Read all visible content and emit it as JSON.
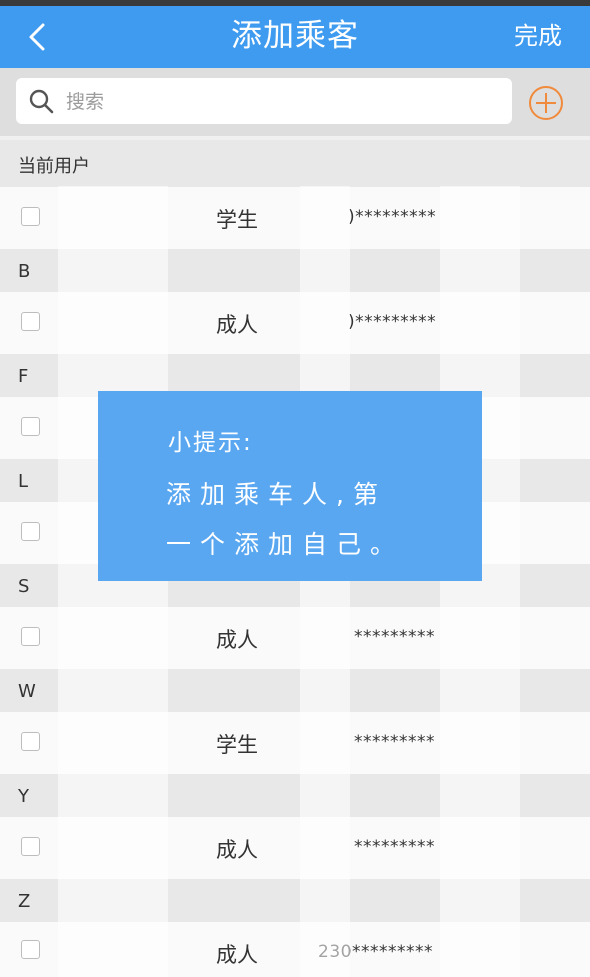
{
  "header": {
    "title": "添加乘客",
    "done_label": "完成"
  },
  "search": {
    "placeholder": "搜索"
  },
  "sections": [
    {
      "label": "当前用户",
      "rows": [
        {
          "type": "学生",
          "id_masked": ")*********"
        }
      ]
    },
    {
      "label": "B",
      "rows": [
        {
          "type": "成人",
          "id_masked": ")*********"
        }
      ]
    },
    {
      "label": "F",
      "rows": [
        {
          "type": "",
          "id_masked": ""
        }
      ]
    },
    {
      "label": "L",
      "rows": [
        {
          "type": "",
          "id_masked": ""
        }
      ]
    },
    {
      "label": "S",
      "rows": [
        {
          "type": "成人",
          "id_masked": "*********"
        }
      ]
    },
    {
      "label": "W",
      "rows": [
        {
          "type": "学生",
          "id_masked": "*********"
        }
      ]
    },
    {
      "label": "Y",
      "rows": [
        {
          "type": "成人",
          "id_masked": "*********"
        }
      ]
    },
    {
      "label": "Z",
      "rows": [
        {
          "type": "成人",
          "id_masked": "230*********"
        }
      ]
    }
  ],
  "tip": {
    "title": "小提示:",
    "line1": "添加乘车人,第",
    "line2": "一个添加自己。"
  },
  "colors": {
    "accent": "#3e9bf0",
    "tip_bg": "#5aa7f1",
    "add_icon": "#f08a3c"
  },
  "icons": {
    "back": "chevron-left-icon",
    "search": "search-icon",
    "add": "plus-circle-icon"
  }
}
